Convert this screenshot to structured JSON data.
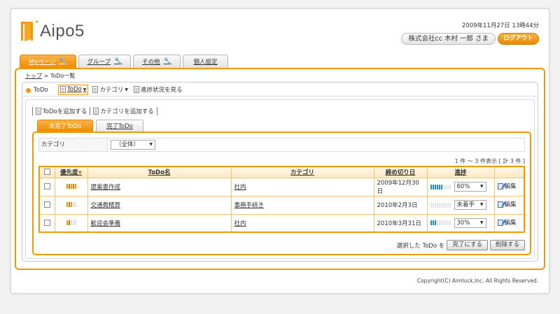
{
  "app": {
    "brand": "Aipo5",
    "datetime": "2009年11月27日 13時44分",
    "user": "株式会社cc 木村 一郎 さま",
    "logout_label": "ログアウト",
    "accent": "#f39800"
  },
  "main_tabs": [
    {
      "label": "Myページ",
      "active": true
    },
    {
      "label": "グループ",
      "active": false
    },
    {
      "label": "その他",
      "active": false
    },
    {
      "label": "個人設定",
      "active": false
    }
  ],
  "breadcrumb": {
    "home": "トップ",
    "sep": ">",
    "current": "ToDo一覧"
  },
  "portlet": {
    "title": "ToDo",
    "toolbar": [
      {
        "label": "ToDo",
        "selected": true,
        "dropdown": true
      },
      {
        "label": "カテゴリ",
        "selected": false,
        "dropdown": true
      },
      {
        "label": "進捗状況を見る",
        "selected": false,
        "dropdown": false
      }
    ],
    "actions": [
      "ToDoを追加する",
      "カテゴリを追加する"
    ],
    "sub_tabs": [
      {
        "label": "未完了ToDo",
        "active": true
      },
      {
        "label": "完了ToDo",
        "active": false
      }
    ],
    "filter": {
      "label": "カテゴリ",
      "value": "（全体）"
    },
    "count": "1 件 ～ 3 件表示 [ 計 3 件 ]",
    "table": {
      "headers": [
        "",
        "優先度",
        "ToDo名",
        "カテゴリ",
        "締め切り日",
        "進捗",
        ""
      ],
      "sort_indicator": "▼",
      "edit_label": "編集",
      "rows": [
        {
          "priority": 5,
          "name": "提案書作成",
          "category": "社内",
          "deadline": "2009年12月30日",
          "progress": 0.6,
          "progress_label": "60%"
        },
        {
          "priority": 3,
          "name": "交通費精算",
          "category": "事務手続き",
          "deadline": "2010年2月3日",
          "progress": 0,
          "progress_label": "未着手"
        },
        {
          "priority": 2,
          "name": "歓迎会準備",
          "category": "社内",
          "deadline": "2010年3月31日",
          "progress": 0.3,
          "progress_label": "30%"
        }
      ]
    },
    "bulk": {
      "prefix": "選択した ToDo を",
      "complete_label": "完了にする",
      "delete_label": "削除する"
    }
  },
  "footer": {
    "copyright": "Copyright(C) Aimluck,Inc. All Rights Reserved."
  }
}
